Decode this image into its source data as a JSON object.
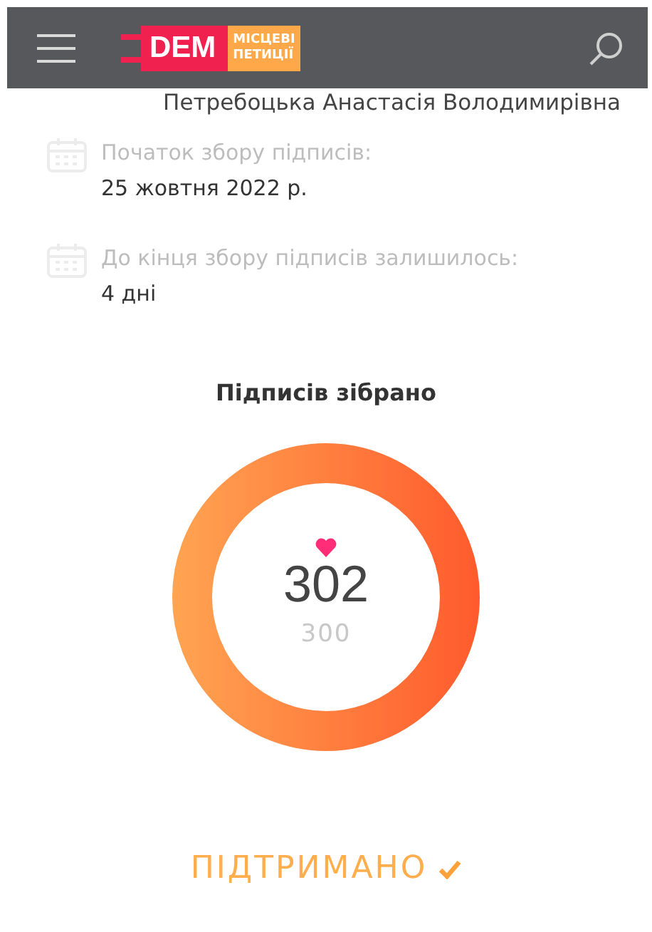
{
  "header": {
    "logo_main": "DEM",
    "logo_sub_lines": [
      "МІСЦЕВІ",
      "ПЕТИЦІЇ"
    ]
  },
  "author_name": "Петребоцька Анастасія Володимирівна",
  "info_rows": [
    {
      "label": "Початок збору підписів:",
      "value": "25 жовтня 2022 р."
    },
    {
      "label": "До кінця збору підписів залишилось:",
      "value": "4 дні"
    }
  ],
  "signatures": {
    "title": "Підписів зібрано",
    "count": "302",
    "goal": "300",
    "level": 1
  },
  "status": {
    "text": "ПІДТРИМАНО",
    "supported": true
  }
}
